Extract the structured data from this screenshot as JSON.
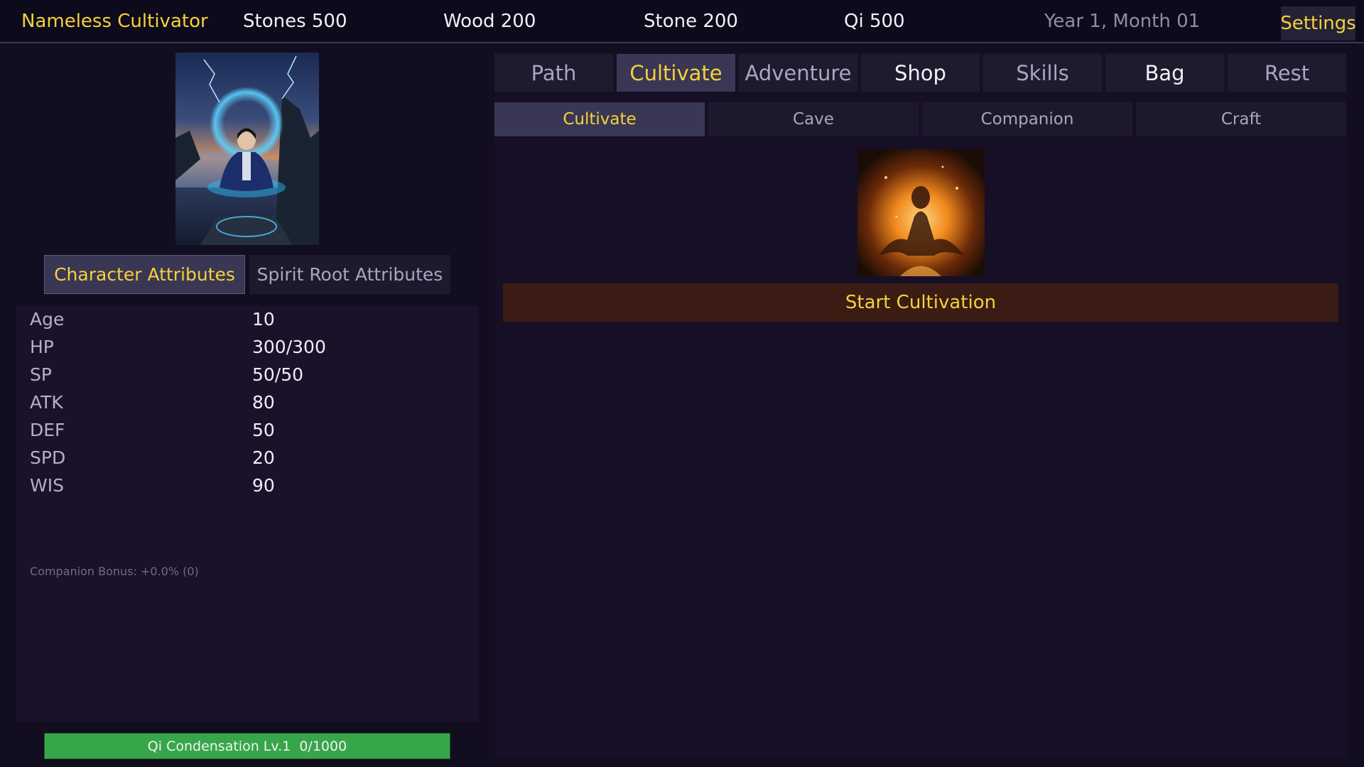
{
  "topbar": {
    "title": "Nameless Cultivator",
    "stones": "Stones 500",
    "wood": "Wood 200",
    "stone": "Stone 200",
    "qi": "Qi 500",
    "date": "Year 1, Month 01",
    "settings_label": "Settings"
  },
  "attribute_tabs": {
    "character": "Character Attributes",
    "spirit_root": "Spirit Root Attributes"
  },
  "stats": [
    {
      "label": "Age",
      "value": "10"
    },
    {
      "label": "HP",
      "value": "300/300"
    },
    {
      "label": "SP",
      "value": "50/50"
    },
    {
      "label": "ATK",
      "value": "80"
    },
    {
      "label": "DEF",
      "value": "50"
    },
    {
      "label": "SPD",
      "value": "20"
    },
    {
      "label": "WIS",
      "value": "90"
    }
  ],
  "companion_bonus": "Companion Bonus: +0.0% (0)",
  "realm": {
    "label": "Qi Condensation Lv.1  0/1000",
    "progress_fraction": 1.0
  },
  "main_tabs": [
    {
      "label": "Path"
    },
    {
      "label": "Cultivate"
    },
    {
      "label": "Adventure"
    },
    {
      "label": "Shop"
    },
    {
      "label": "Skills"
    },
    {
      "label": "Bag"
    },
    {
      "label": "Rest"
    }
  ],
  "sub_tabs": [
    {
      "label": "Cultivate"
    },
    {
      "label": "Cave"
    },
    {
      "label": "Companion"
    },
    {
      "label": "Craft"
    }
  ],
  "start_button_label": "Start Cultivation",
  "colors": {
    "accent_gold": "#f5d13a",
    "progress_green": "#37a64a",
    "start_button_bg": "#3a1c14"
  }
}
